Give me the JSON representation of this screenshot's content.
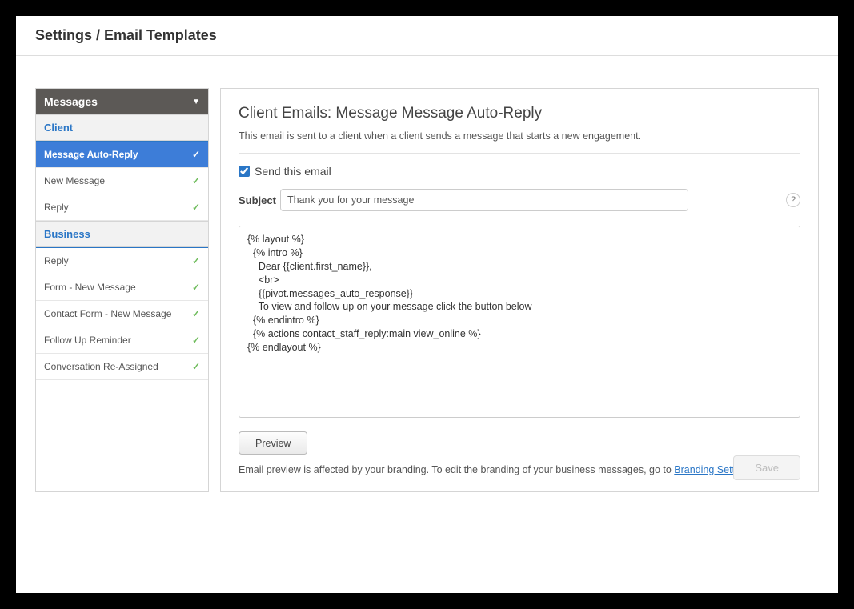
{
  "header": {
    "title": "Settings / Email Templates"
  },
  "sidebar": {
    "title": "Messages",
    "sections": [
      {
        "label": "Client",
        "items": [
          {
            "label": "Message Auto-Reply",
            "active": true
          },
          {
            "label": "New Message"
          },
          {
            "label": "Reply"
          }
        ]
      },
      {
        "label": "Business",
        "items": [
          {
            "label": "Reply"
          },
          {
            "label": "Form - New Message"
          },
          {
            "label": "Contact Form - New Message"
          },
          {
            "label": "Follow Up Reminder"
          },
          {
            "label": "Conversation Re-Assigned"
          }
        ]
      }
    ]
  },
  "main": {
    "title": "Client Emails: Message Message Auto-Reply",
    "description": "This email is sent to a client when a client sends a message that starts a new engagement.",
    "send_label": "Send this email",
    "send_checked": true,
    "subject_label": "Subject",
    "subject_value": "Thank you for your message",
    "help_icon": "?",
    "editor_value": "{% layout %}\n  {% intro %}\n    Dear {{client.first_name}},\n    <br>\n    {{pivot.messages_auto_response}}\n    To view and follow-up on your message click the button below\n  {% endintro %}\n  {% actions contact_staff_reply:main view_online %}\n{% endlayout %}",
    "preview_label": "Preview",
    "note_prefix": "Email preview is affected by your branding. To edit the branding of your business messages, go to ",
    "note_link": "Branding Settings",
    "save_label": "Save"
  }
}
